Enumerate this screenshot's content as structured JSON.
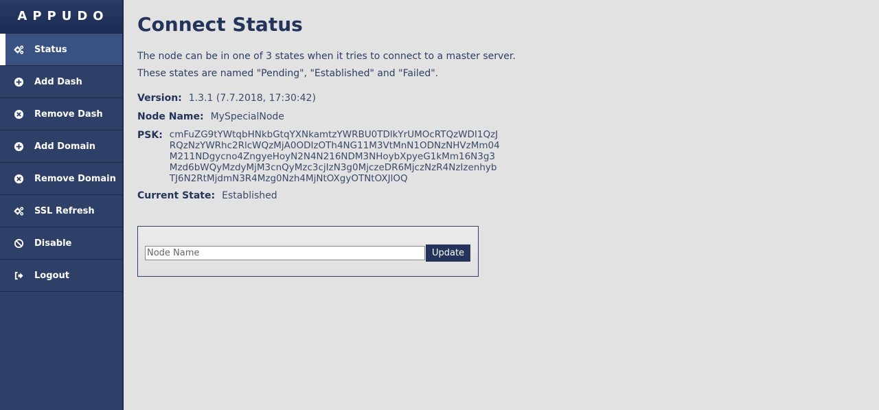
{
  "brand": "APPUDO",
  "sidebar": {
    "items": [
      {
        "label": "Status",
        "icon": "gears-icon",
        "active": true
      },
      {
        "label": "Add Dash",
        "icon": "plus-circle-icon"
      },
      {
        "label": "Remove Dash",
        "icon": "x-circle-icon"
      },
      {
        "label": "Add Domain",
        "icon": "plus-circle-icon"
      },
      {
        "label": "Remove Domain",
        "icon": "x-circle-icon"
      },
      {
        "label": "SSL Refresh",
        "icon": "gears-icon"
      },
      {
        "label": "Disable",
        "icon": "ban-icon"
      },
      {
        "label": "Logout",
        "icon": "sign-out-icon"
      }
    ]
  },
  "main": {
    "title": "Connect Status",
    "description_line1": "The node can be in one of 3 states when it tries to connect to a master server.",
    "description_line2": "These states are named \"Pending\", \"Established\" and \"Failed\".",
    "version_label": "Version:",
    "version_value": "1.3.1 (7.7.2018, 17:30:42)",
    "node_name_label": "Node Name:",
    "node_name_value": "MySpecialNode",
    "psk_label": "PSK:",
    "psk_value": "cmFuZG9tYWtqbHNkbGtqYXNkamtzYWRBU0TDlkYrUMOcRTQzWDI1QzJ\nRQzNzYWRhc2RlcWQzMjA0ODIzOTh4NG11M3VtMnN1ODNzNHVzMm04\nM211NDgycno4ZngyeHoyN2N4N216NDM3NHoybXpyeG1kMm16N3g3\nMzd6bWQyMzdyMjM3cnQyMzc3cjIzN3g0MjczeDR6MjczNzR4NzIzenhyb\nTJ6N2RtMjdmN3R4Mzg0Nzh4MjNtOXgyOTNtOXJlOQ",
    "state_label": "Current State:",
    "state_value": "Established"
  },
  "form": {
    "node_name_placeholder": "Node Name",
    "update_label": "Update"
  }
}
